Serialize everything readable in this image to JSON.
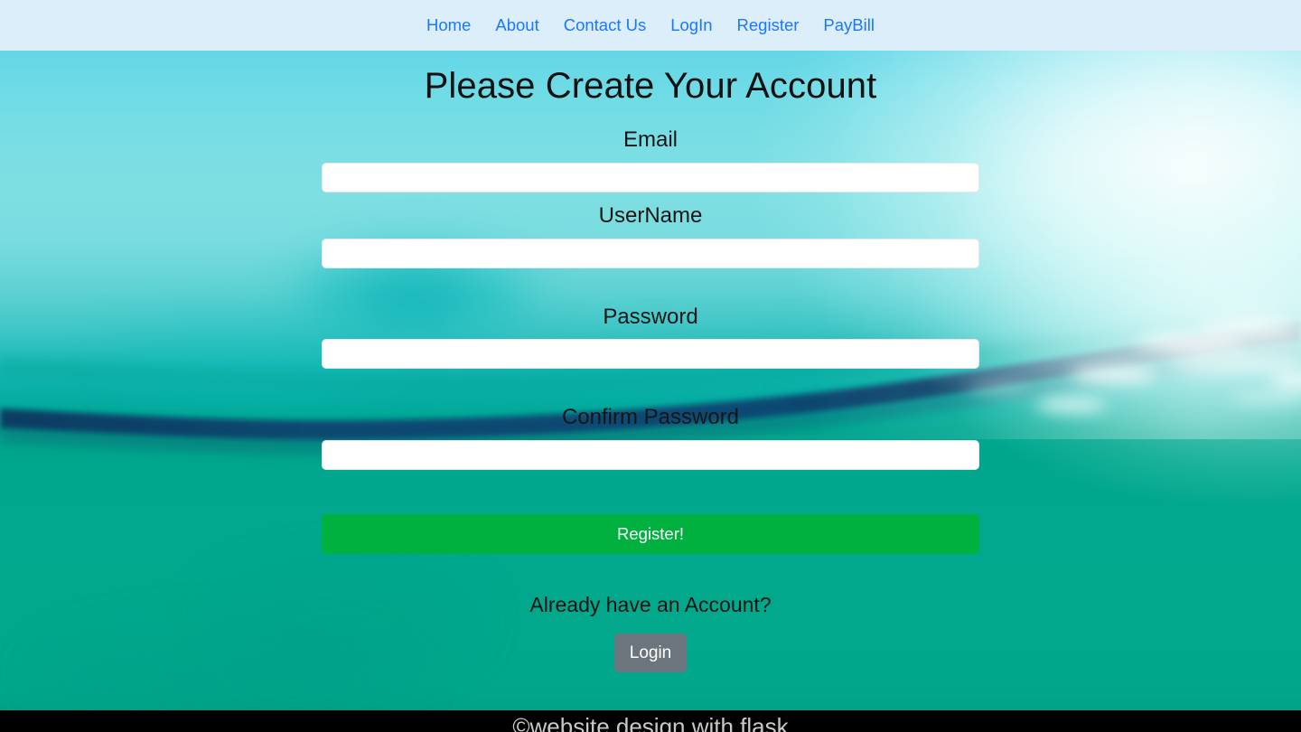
{
  "navbar": {
    "items": [
      {
        "label": "Home",
        "name": "nav-link-home"
      },
      {
        "label": "About",
        "name": "nav-link-about"
      },
      {
        "label": "Contact Us",
        "name": "nav-link-contact-us"
      },
      {
        "label": "LogIn",
        "name": "nav-link-login"
      },
      {
        "label": "Register",
        "name": "nav-link-register"
      },
      {
        "label": "PayBill",
        "name": "nav-link-paybill"
      }
    ],
    "background_color": "#ddeefb",
    "link_color": "#1a78ff"
  },
  "main": {
    "title": "Please Create Your Account",
    "fields": {
      "email": {
        "label": "Email",
        "value": "",
        "placeholder": ""
      },
      "username": {
        "label": "UserName",
        "value": "",
        "placeholder": ""
      },
      "password": {
        "label": "Password",
        "value": "",
        "placeholder": ""
      },
      "confirm_password": {
        "label": "Confirm Password",
        "value": "",
        "placeholder": ""
      }
    },
    "register_button": {
      "label": "Register!",
      "color": "#00b140",
      "text_color": "#ffffff"
    },
    "already_have_account_text": "Already have an Account?",
    "login_button": {
      "label": "Login",
      "color": "#6c757d",
      "text_color": "#ffffff"
    }
  },
  "footer": {
    "text": "©website design with flask",
    "background_color": "#000000",
    "text_color": "#c9c9c9"
  },
  "theme": {
    "background_top_color": "#63d6e6",
    "background_bottom_color": "#01a88c",
    "horizon_color": "#0d3f66",
    "input_background": "#ffffff"
  }
}
